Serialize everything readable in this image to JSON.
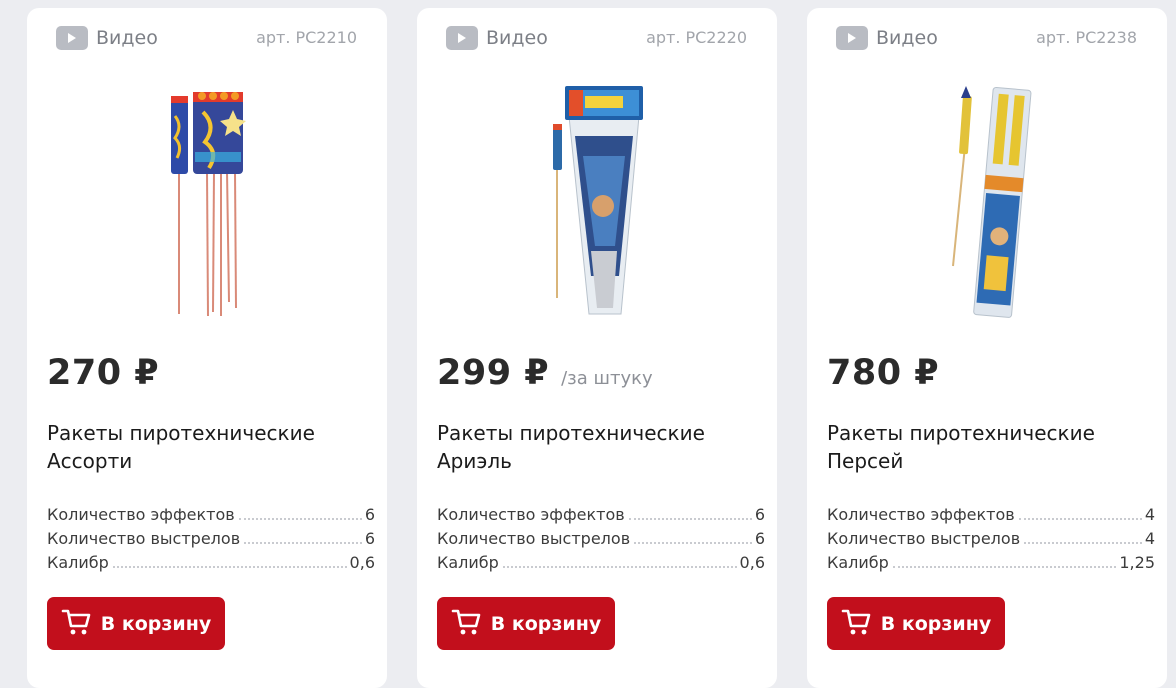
{
  "colors": {
    "accent": "#c20f1c",
    "background": "#ecedf1",
    "card": "#ffffff"
  },
  "products": [
    {
      "video_label": "Видео",
      "article_prefix": "арт.",
      "article": "РС2210",
      "price": "270 ₽",
      "per_unit": "",
      "title": "Ракеты пиротехнические Ассорти",
      "specs": [
        {
          "label": "Количество эффектов",
          "value": "6"
        },
        {
          "label": "Количество выстрелов",
          "value": "6"
        },
        {
          "label": "Калибр",
          "value": "0,6"
        }
      ],
      "cart_label": "В корзину",
      "icons": {
        "video": "play-icon",
        "cart": "cart-icon"
      }
    },
    {
      "video_label": "Видео",
      "article_prefix": "арт.",
      "article": "РС2220",
      "price": "299 ₽",
      "per_unit": "/за штуку",
      "title": "Ракеты пиротехнические Ариэль",
      "specs": [
        {
          "label": "Количество эффектов",
          "value": "6"
        },
        {
          "label": "Количество выстрелов",
          "value": "6"
        },
        {
          "label": "Калибр",
          "value": "0,6"
        }
      ],
      "cart_label": "В корзину",
      "icons": {
        "video": "play-icon",
        "cart": "cart-icon"
      }
    },
    {
      "video_label": "Видео",
      "article_prefix": "арт.",
      "article": "РС2238",
      "price": "780 ₽",
      "per_unit": "",
      "title": "Ракеты пиротехнические Персей",
      "specs": [
        {
          "label": "Количество эффектов",
          "value": "4"
        },
        {
          "label": "Количество выстрелов",
          "value": "4"
        },
        {
          "label": "Калибр",
          "value": "1,25"
        }
      ],
      "cart_label": "В корзину",
      "icons": {
        "video": "play-icon",
        "cart": "cart-icon"
      }
    }
  ]
}
